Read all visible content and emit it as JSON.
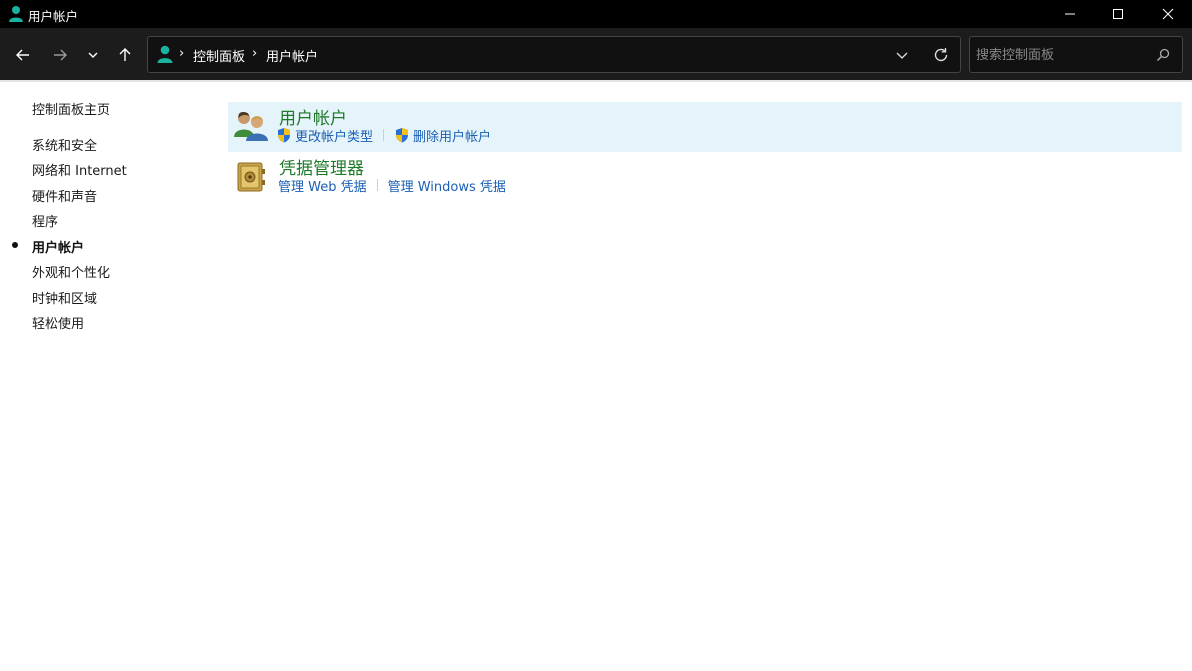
{
  "window": {
    "title": "用户帐户"
  },
  "breadcrumb": {
    "items": [
      "控制面板",
      "用户帐户"
    ]
  },
  "search": {
    "placeholder": "搜索控制面板"
  },
  "sidebar": {
    "home": "控制面板主页",
    "items": [
      {
        "label": "系统和安全",
        "active": false
      },
      {
        "label": "网络和 Internet",
        "active": false
      },
      {
        "label": "硬件和声音",
        "active": false
      },
      {
        "label": "程序",
        "active": false
      },
      {
        "label": "用户帐户",
        "active": true
      },
      {
        "label": "外观和个性化",
        "active": false
      },
      {
        "label": "时钟和区域",
        "active": false
      },
      {
        "label": "轻松使用",
        "active": false
      }
    ]
  },
  "categories": [
    {
      "title": "用户帐户",
      "icon": "users-icon",
      "links": [
        "更改帐户类型",
        "删除用户帐户"
      ]
    },
    {
      "title": "凭据管理器",
      "icon": "vault-icon",
      "links": [
        "管理 Web 凭据",
        "管理 Windows 凭据"
      ]
    }
  ],
  "colors": {
    "link": "#1a5fb4",
    "category_title": "#1e7a28",
    "highlight": "#e5f3fb",
    "titlebar": "#000000",
    "navbar": "#1c1c1c"
  }
}
